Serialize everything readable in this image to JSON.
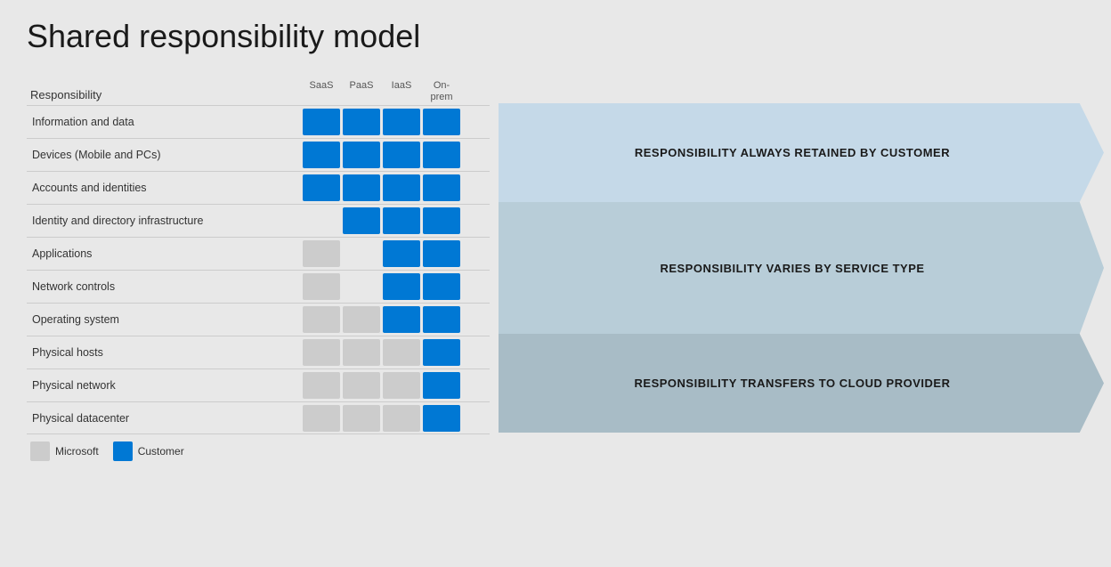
{
  "title": "Shared responsibility model",
  "table": {
    "header": {
      "row_header": "Responsibility",
      "columns": [
        "SaaS",
        "PaaS",
        "IaaS",
        "On-\nprem"
      ]
    },
    "rows": [
      {
        "label": "Information and data",
        "cells": [
          "blue",
          "blue",
          "blue",
          "blue"
        ]
      },
      {
        "label": "Devices (Mobile and PCs)",
        "cells": [
          "blue",
          "blue",
          "blue",
          "blue"
        ]
      },
      {
        "label": "Accounts and identities",
        "cells": [
          "blue",
          "blue",
          "blue",
          "blue"
        ]
      },
      {
        "label": "Identity and directory infrastructure",
        "cells": [
          "half",
          "blue",
          "blue",
          "blue"
        ]
      },
      {
        "label": "Applications",
        "cells": [
          "gray",
          "half",
          "blue",
          "blue"
        ]
      },
      {
        "label": "Network controls",
        "cells": [
          "gray",
          "half",
          "blue",
          "blue"
        ]
      },
      {
        "label": "Operating system",
        "cells": [
          "gray",
          "gray",
          "blue",
          "blue"
        ]
      },
      {
        "label": "Physical hosts",
        "cells": [
          "gray",
          "gray",
          "gray",
          "blue"
        ]
      },
      {
        "label": "Physical network",
        "cells": [
          "gray",
          "gray",
          "gray",
          "blue"
        ]
      },
      {
        "label": "Physical datacenter",
        "cells": [
          "gray",
          "gray",
          "gray",
          "blue"
        ]
      }
    ]
  },
  "arrows": [
    {
      "text": "RESPONSIBILITY ALWAYS RETAINED BY CUSTOMER",
      "rows": 3
    },
    {
      "text": "RESPONSIBILITY VARIES BY SERVICE TYPE",
      "rows": 4
    },
    {
      "text": "RESPONSIBILITY TRANSFERS TO CLOUD PROVIDER",
      "rows": 3
    }
  ],
  "legend": {
    "microsoft_label": "Microsoft",
    "customer_label": "Customer"
  }
}
